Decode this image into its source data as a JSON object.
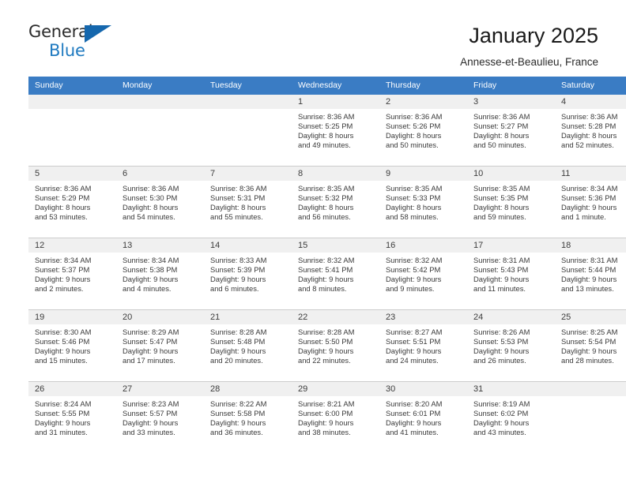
{
  "brand": {
    "name_top": "General",
    "name_bottom": "Blue",
    "triangle_color": "#1567ad",
    "blue_text_color": "#1f7ac0"
  },
  "header": {
    "title": "January 2025",
    "subtitle": "Annesse-et-Beaulieu, France",
    "header_bg": "#3a7cc4",
    "daynum_band_bg": "#f0f0f0"
  },
  "weekday_headers": [
    "Sunday",
    "Monday",
    "Tuesday",
    "Wednesday",
    "Thursday",
    "Friday",
    "Saturday"
  ],
  "labels": {
    "sunrise_prefix": "Sunrise:",
    "sunset_prefix": "Sunset:",
    "daylight_prefix": "Daylight:"
  },
  "weeks": [
    [
      {
        "day": "",
        "empty": true,
        "sunrise": "",
        "sunset": "",
        "daylight_line1": "",
        "daylight_line2": ""
      },
      {
        "day": "",
        "empty": true,
        "sunrise": "",
        "sunset": "",
        "daylight_line1": "",
        "daylight_line2": ""
      },
      {
        "day": "",
        "empty": true,
        "sunrise": "",
        "sunset": "",
        "daylight_line1": "",
        "daylight_line2": ""
      },
      {
        "day": "1",
        "empty": false,
        "sunrise": "Sunrise: 8:36 AM",
        "sunset": "Sunset: 5:25 PM",
        "daylight_line1": "Daylight: 8 hours",
        "daylight_line2": "and 49 minutes."
      },
      {
        "day": "2",
        "empty": false,
        "sunrise": "Sunrise: 8:36 AM",
        "sunset": "Sunset: 5:26 PM",
        "daylight_line1": "Daylight: 8 hours",
        "daylight_line2": "and 50 minutes."
      },
      {
        "day": "3",
        "empty": false,
        "sunrise": "Sunrise: 8:36 AM",
        "sunset": "Sunset: 5:27 PM",
        "daylight_line1": "Daylight: 8 hours",
        "daylight_line2": "and 50 minutes."
      },
      {
        "day": "4",
        "empty": false,
        "sunrise": "Sunrise: 8:36 AM",
        "sunset": "Sunset: 5:28 PM",
        "daylight_line1": "Daylight: 8 hours",
        "daylight_line2": "and 52 minutes."
      }
    ],
    [
      {
        "day": "5",
        "empty": false,
        "sunrise": "Sunrise: 8:36 AM",
        "sunset": "Sunset: 5:29 PM",
        "daylight_line1": "Daylight: 8 hours",
        "daylight_line2": "and 53 minutes."
      },
      {
        "day": "6",
        "empty": false,
        "sunrise": "Sunrise: 8:36 AM",
        "sunset": "Sunset: 5:30 PM",
        "daylight_line1": "Daylight: 8 hours",
        "daylight_line2": "and 54 minutes."
      },
      {
        "day": "7",
        "empty": false,
        "sunrise": "Sunrise: 8:36 AM",
        "sunset": "Sunset: 5:31 PM",
        "daylight_line1": "Daylight: 8 hours",
        "daylight_line2": "and 55 minutes."
      },
      {
        "day": "8",
        "empty": false,
        "sunrise": "Sunrise: 8:35 AM",
        "sunset": "Sunset: 5:32 PM",
        "daylight_line1": "Daylight: 8 hours",
        "daylight_line2": "and 56 minutes."
      },
      {
        "day": "9",
        "empty": false,
        "sunrise": "Sunrise: 8:35 AM",
        "sunset": "Sunset: 5:33 PM",
        "daylight_line1": "Daylight: 8 hours",
        "daylight_line2": "and 58 minutes."
      },
      {
        "day": "10",
        "empty": false,
        "sunrise": "Sunrise: 8:35 AM",
        "sunset": "Sunset: 5:35 PM",
        "daylight_line1": "Daylight: 8 hours",
        "daylight_line2": "and 59 minutes."
      },
      {
        "day": "11",
        "empty": false,
        "sunrise": "Sunrise: 8:34 AM",
        "sunset": "Sunset: 5:36 PM",
        "daylight_line1": "Daylight: 9 hours",
        "daylight_line2": "and 1 minute."
      }
    ],
    [
      {
        "day": "12",
        "empty": false,
        "sunrise": "Sunrise: 8:34 AM",
        "sunset": "Sunset: 5:37 PM",
        "daylight_line1": "Daylight: 9 hours",
        "daylight_line2": "and 2 minutes."
      },
      {
        "day": "13",
        "empty": false,
        "sunrise": "Sunrise: 8:34 AM",
        "sunset": "Sunset: 5:38 PM",
        "daylight_line1": "Daylight: 9 hours",
        "daylight_line2": "and 4 minutes."
      },
      {
        "day": "14",
        "empty": false,
        "sunrise": "Sunrise: 8:33 AM",
        "sunset": "Sunset: 5:39 PM",
        "daylight_line1": "Daylight: 9 hours",
        "daylight_line2": "and 6 minutes."
      },
      {
        "day": "15",
        "empty": false,
        "sunrise": "Sunrise: 8:32 AM",
        "sunset": "Sunset: 5:41 PM",
        "daylight_line1": "Daylight: 9 hours",
        "daylight_line2": "and 8 minutes."
      },
      {
        "day": "16",
        "empty": false,
        "sunrise": "Sunrise: 8:32 AM",
        "sunset": "Sunset: 5:42 PM",
        "daylight_line1": "Daylight: 9 hours",
        "daylight_line2": "and 9 minutes."
      },
      {
        "day": "17",
        "empty": false,
        "sunrise": "Sunrise: 8:31 AM",
        "sunset": "Sunset: 5:43 PM",
        "daylight_line1": "Daylight: 9 hours",
        "daylight_line2": "and 11 minutes."
      },
      {
        "day": "18",
        "empty": false,
        "sunrise": "Sunrise: 8:31 AM",
        "sunset": "Sunset: 5:44 PM",
        "daylight_line1": "Daylight: 9 hours",
        "daylight_line2": "and 13 minutes."
      }
    ],
    [
      {
        "day": "19",
        "empty": false,
        "sunrise": "Sunrise: 8:30 AM",
        "sunset": "Sunset: 5:46 PM",
        "daylight_line1": "Daylight: 9 hours",
        "daylight_line2": "and 15 minutes."
      },
      {
        "day": "20",
        "empty": false,
        "sunrise": "Sunrise: 8:29 AM",
        "sunset": "Sunset: 5:47 PM",
        "daylight_line1": "Daylight: 9 hours",
        "daylight_line2": "and 17 minutes."
      },
      {
        "day": "21",
        "empty": false,
        "sunrise": "Sunrise: 8:28 AM",
        "sunset": "Sunset: 5:48 PM",
        "daylight_line1": "Daylight: 9 hours",
        "daylight_line2": "and 20 minutes."
      },
      {
        "day": "22",
        "empty": false,
        "sunrise": "Sunrise: 8:28 AM",
        "sunset": "Sunset: 5:50 PM",
        "daylight_line1": "Daylight: 9 hours",
        "daylight_line2": "and 22 minutes."
      },
      {
        "day": "23",
        "empty": false,
        "sunrise": "Sunrise: 8:27 AM",
        "sunset": "Sunset: 5:51 PM",
        "daylight_line1": "Daylight: 9 hours",
        "daylight_line2": "and 24 minutes."
      },
      {
        "day": "24",
        "empty": false,
        "sunrise": "Sunrise: 8:26 AM",
        "sunset": "Sunset: 5:53 PM",
        "daylight_line1": "Daylight: 9 hours",
        "daylight_line2": "and 26 minutes."
      },
      {
        "day": "25",
        "empty": false,
        "sunrise": "Sunrise: 8:25 AM",
        "sunset": "Sunset: 5:54 PM",
        "daylight_line1": "Daylight: 9 hours",
        "daylight_line2": "and 28 minutes."
      }
    ],
    [
      {
        "day": "26",
        "empty": false,
        "sunrise": "Sunrise: 8:24 AM",
        "sunset": "Sunset: 5:55 PM",
        "daylight_line1": "Daylight: 9 hours",
        "daylight_line2": "and 31 minutes."
      },
      {
        "day": "27",
        "empty": false,
        "sunrise": "Sunrise: 8:23 AM",
        "sunset": "Sunset: 5:57 PM",
        "daylight_line1": "Daylight: 9 hours",
        "daylight_line2": "and 33 minutes."
      },
      {
        "day": "28",
        "empty": false,
        "sunrise": "Sunrise: 8:22 AM",
        "sunset": "Sunset: 5:58 PM",
        "daylight_line1": "Daylight: 9 hours",
        "daylight_line2": "and 36 minutes."
      },
      {
        "day": "29",
        "empty": false,
        "sunrise": "Sunrise: 8:21 AM",
        "sunset": "Sunset: 6:00 PM",
        "daylight_line1": "Daylight: 9 hours",
        "daylight_line2": "and 38 minutes."
      },
      {
        "day": "30",
        "empty": false,
        "sunrise": "Sunrise: 8:20 AM",
        "sunset": "Sunset: 6:01 PM",
        "daylight_line1": "Daylight: 9 hours",
        "daylight_line2": "and 41 minutes."
      },
      {
        "day": "31",
        "empty": false,
        "sunrise": "Sunrise: 8:19 AM",
        "sunset": "Sunset: 6:02 PM",
        "daylight_line1": "Daylight: 9 hours",
        "daylight_line2": "and 43 minutes."
      },
      {
        "day": "",
        "empty": true,
        "sunrise": "",
        "sunset": "",
        "daylight_line1": "",
        "daylight_line2": ""
      }
    ]
  ]
}
